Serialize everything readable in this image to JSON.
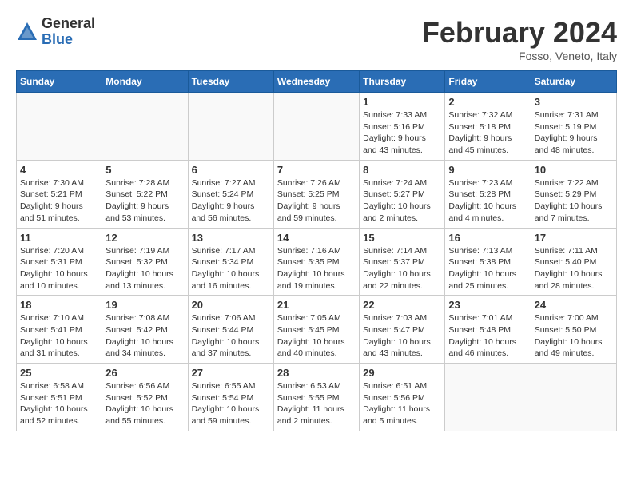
{
  "header": {
    "logo_general": "General",
    "logo_blue": "Blue",
    "month_title": "February 2024",
    "location": "Fosso, Veneto, Italy"
  },
  "days_of_week": [
    "Sunday",
    "Monday",
    "Tuesday",
    "Wednesday",
    "Thursday",
    "Friday",
    "Saturday"
  ],
  "weeks": [
    [
      {
        "day": "",
        "info": ""
      },
      {
        "day": "",
        "info": ""
      },
      {
        "day": "",
        "info": ""
      },
      {
        "day": "",
        "info": ""
      },
      {
        "day": "1",
        "info": "Sunrise: 7:33 AM\nSunset: 5:16 PM\nDaylight: 9 hours\nand 43 minutes."
      },
      {
        "day": "2",
        "info": "Sunrise: 7:32 AM\nSunset: 5:18 PM\nDaylight: 9 hours\nand 45 minutes."
      },
      {
        "day": "3",
        "info": "Sunrise: 7:31 AM\nSunset: 5:19 PM\nDaylight: 9 hours\nand 48 minutes."
      }
    ],
    [
      {
        "day": "4",
        "info": "Sunrise: 7:30 AM\nSunset: 5:21 PM\nDaylight: 9 hours\nand 51 minutes."
      },
      {
        "day": "5",
        "info": "Sunrise: 7:28 AM\nSunset: 5:22 PM\nDaylight: 9 hours\nand 53 minutes."
      },
      {
        "day": "6",
        "info": "Sunrise: 7:27 AM\nSunset: 5:24 PM\nDaylight: 9 hours\nand 56 minutes."
      },
      {
        "day": "7",
        "info": "Sunrise: 7:26 AM\nSunset: 5:25 PM\nDaylight: 9 hours\nand 59 minutes."
      },
      {
        "day": "8",
        "info": "Sunrise: 7:24 AM\nSunset: 5:27 PM\nDaylight: 10 hours\nand 2 minutes."
      },
      {
        "day": "9",
        "info": "Sunrise: 7:23 AM\nSunset: 5:28 PM\nDaylight: 10 hours\nand 4 minutes."
      },
      {
        "day": "10",
        "info": "Sunrise: 7:22 AM\nSunset: 5:29 PM\nDaylight: 10 hours\nand 7 minutes."
      }
    ],
    [
      {
        "day": "11",
        "info": "Sunrise: 7:20 AM\nSunset: 5:31 PM\nDaylight: 10 hours\nand 10 minutes."
      },
      {
        "day": "12",
        "info": "Sunrise: 7:19 AM\nSunset: 5:32 PM\nDaylight: 10 hours\nand 13 minutes."
      },
      {
        "day": "13",
        "info": "Sunrise: 7:17 AM\nSunset: 5:34 PM\nDaylight: 10 hours\nand 16 minutes."
      },
      {
        "day": "14",
        "info": "Sunrise: 7:16 AM\nSunset: 5:35 PM\nDaylight: 10 hours\nand 19 minutes."
      },
      {
        "day": "15",
        "info": "Sunrise: 7:14 AM\nSunset: 5:37 PM\nDaylight: 10 hours\nand 22 minutes."
      },
      {
        "day": "16",
        "info": "Sunrise: 7:13 AM\nSunset: 5:38 PM\nDaylight: 10 hours\nand 25 minutes."
      },
      {
        "day": "17",
        "info": "Sunrise: 7:11 AM\nSunset: 5:40 PM\nDaylight: 10 hours\nand 28 minutes."
      }
    ],
    [
      {
        "day": "18",
        "info": "Sunrise: 7:10 AM\nSunset: 5:41 PM\nDaylight: 10 hours\nand 31 minutes."
      },
      {
        "day": "19",
        "info": "Sunrise: 7:08 AM\nSunset: 5:42 PM\nDaylight: 10 hours\nand 34 minutes."
      },
      {
        "day": "20",
        "info": "Sunrise: 7:06 AM\nSunset: 5:44 PM\nDaylight: 10 hours\nand 37 minutes."
      },
      {
        "day": "21",
        "info": "Sunrise: 7:05 AM\nSunset: 5:45 PM\nDaylight: 10 hours\nand 40 minutes."
      },
      {
        "day": "22",
        "info": "Sunrise: 7:03 AM\nSunset: 5:47 PM\nDaylight: 10 hours\nand 43 minutes."
      },
      {
        "day": "23",
        "info": "Sunrise: 7:01 AM\nSunset: 5:48 PM\nDaylight: 10 hours\nand 46 minutes."
      },
      {
        "day": "24",
        "info": "Sunrise: 7:00 AM\nSunset: 5:50 PM\nDaylight: 10 hours\nand 49 minutes."
      }
    ],
    [
      {
        "day": "25",
        "info": "Sunrise: 6:58 AM\nSunset: 5:51 PM\nDaylight: 10 hours\nand 52 minutes."
      },
      {
        "day": "26",
        "info": "Sunrise: 6:56 AM\nSunset: 5:52 PM\nDaylight: 10 hours\nand 55 minutes."
      },
      {
        "day": "27",
        "info": "Sunrise: 6:55 AM\nSunset: 5:54 PM\nDaylight: 10 hours\nand 59 minutes."
      },
      {
        "day": "28",
        "info": "Sunrise: 6:53 AM\nSunset: 5:55 PM\nDaylight: 11 hours\nand 2 minutes."
      },
      {
        "day": "29",
        "info": "Sunrise: 6:51 AM\nSunset: 5:56 PM\nDaylight: 11 hours\nand 5 minutes."
      },
      {
        "day": "",
        "info": ""
      },
      {
        "day": "",
        "info": ""
      }
    ]
  ]
}
